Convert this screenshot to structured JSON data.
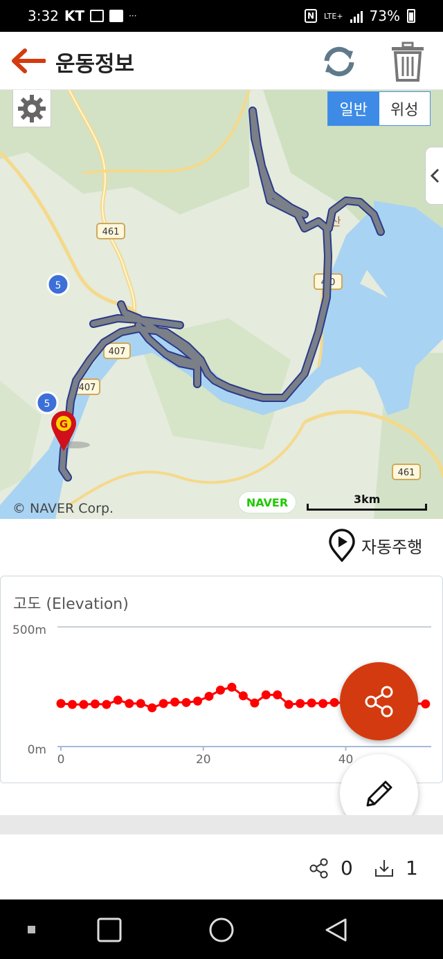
{
  "status_bar": {
    "time": "3:32",
    "carrier": "KT",
    "overflow": "···",
    "network": "LTE+",
    "battery": "73%"
  },
  "header": {
    "title": "운동정보",
    "icons": [
      "back-arrow-icon",
      "refresh-icon",
      "trash-icon"
    ],
    "accent_color": "#d43a0f"
  },
  "map": {
    "view_toggle": {
      "normal_label": "일반",
      "satellite_label": "위성",
      "selected": "일반"
    },
    "labels": {
      "route_461_a": "461",
      "route_461_b": "461",
      "route_461_c": "461",
      "route_407_a": "407",
      "route_407_b": "407",
      "route_4x0": "4 0",
      "expressway_5_a": "5",
      "expressway_5_b": "5",
      "mountain": "산"
    },
    "marker_letter": "G",
    "copyright": "© NAVER Corp.",
    "provider_logo": "NAVER",
    "scale_label": "3km",
    "track_color": "#7b7f87"
  },
  "autoplay": {
    "label": "자동주행",
    "icon": "play-pin-icon"
  },
  "elevation_chart": {
    "title": "고도 (Elevation)",
    "chart_data": {
      "type": "line",
      "title": "고도 (Elevation)",
      "ylim": [
        0,
        500
      ],
      "y_ticks": [
        "0m",
        "500m"
      ],
      "x_ticks": [
        0,
        20,
        40
      ],
      "xlim": [
        0,
        52
      ],
      "grid": true,
      "series_color": "#ff0000",
      "x": [
        0,
        1.6,
        3.2,
        4.8,
        6.4,
        8.0,
        9.6,
        11.2,
        12.8,
        14.4,
        16.0,
        17.6,
        19.2,
        20.8,
        22.4,
        24.0,
        25.6,
        27.2,
        28.8,
        30.4,
        32.0,
        33.6,
        35.2,
        36.8,
        38.4,
        40.0,
        41.6,
        43.2,
        44.8,
        46.4,
        48.0,
        49.6,
        51.2
      ],
      "values": [
        180,
        176,
        176,
        178,
        176,
        194,
        180,
        180,
        162,
        180,
        186,
        184,
        190,
        210,
        236,
        248,
        212,
        182,
        216,
        216,
        176,
        180,
        182,
        180,
        184,
        182,
        182,
        184,
        180,
        182,
        182,
        180,
        178
      ]
    }
  },
  "fabs": {
    "share_icon": "share-icon",
    "edit_icon": "pencil-icon"
  },
  "footer": {
    "share_count": "0",
    "download_count": "1"
  },
  "nav_bar": {
    "icons": [
      "recents-dot-icon",
      "overview-square-icon",
      "home-circle-icon",
      "back-triangle-icon"
    ]
  }
}
